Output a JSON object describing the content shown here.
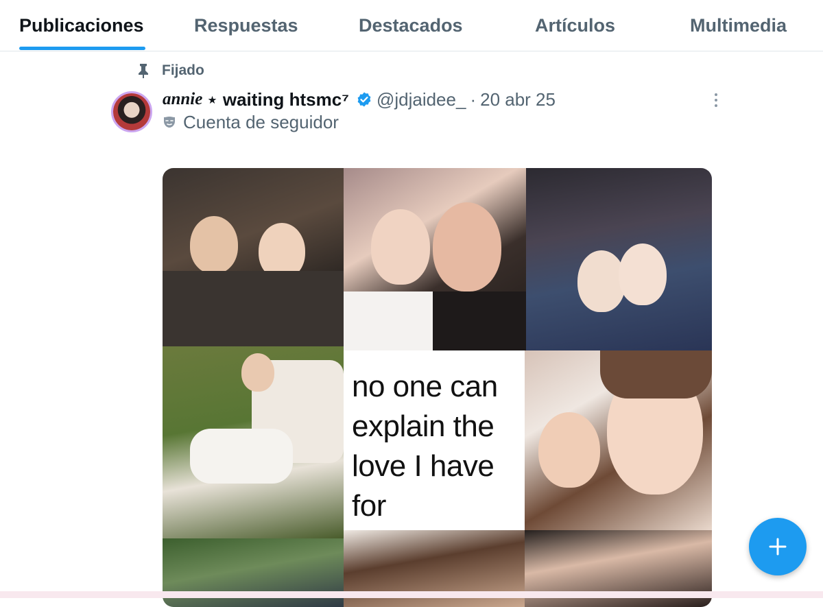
{
  "tabs": [
    {
      "label": "Publicaciones",
      "active": true
    },
    {
      "label": "Respuestas",
      "active": false
    },
    {
      "label": "Destacados",
      "active": false
    },
    {
      "label": "Artículos",
      "active": false
    },
    {
      "label": "Multimedia",
      "active": false
    }
  ],
  "pinned": {
    "label": "Fijado",
    "icon": "pin-icon"
  },
  "post": {
    "display_name_italic": "annie",
    "display_name_rest": "⋆ waiting htsmc⁷",
    "verified": true,
    "handle": "@jdjaidee_",
    "separator": "·",
    "date": "20 abr 25",
    "account_type_label": "Cuenta de seguidor",
    "more_icon": "more-vertical-icon",
    "media": {
      "meme_text": "no one can\nexplain the\nlove I have\nfor"
    }
  },
  "fab": {
    "icon": "plus-icon"
  },
  "colors": {
    "accent": "#1d9bf0",
    "muted": "#536471",
    "text": "#0f1419"
  }
}
